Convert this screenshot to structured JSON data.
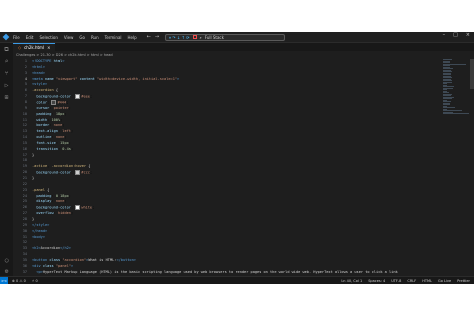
{
  "menu": [
    "File",
    "Edit",
    "Selection",
    "View",
    "Go",
    "Run",
    "Terminal",
    "Help"
  ],
  "search_text": "Full Stack",
  "tab": {
    "label": "ch2k.html"
  },
  "breadcrumb": "Challenges > 21-30 > D26 > ch2k.html > html > head",
  "code_lines": [
    {
      "n": "1",
      "h": "<span class='tag'>&lt;!DOCTYPE</span> <span class='att'>html</span><span class='tag'>&gt;</span>"
    },
    {
      "n": "2",
      "h": "<span class='tag'>&lt;html&gt;</span>"
    },
    {
      "n": "3",
      "h": "<span class='tag'>&lt;head&gt;</span>"
    },
    {
      "n": "4",
      "h": "<span class='tag'>&lt;meta</span> <span class='att'>name</span>=<span class='str'>\"viewport\"</span> <span class='att'>content</span>=<span class='str'>\"width=device-width, initial-scale=1\"</span><span class='tag'>&gt;</span>"
    },
    {
      "n": "5",
      "h": "<span class='tag'>&lt;style&gt;</span>"
    },
    {
      "n": "6",
      "h": "<span class='sel'>.accordion</span> <span class='pun'>{</span>"
    },
    {
      "n": "7",
      "h": "  <span class='prop'>background-color</span>: <span class='sw' style='background:#eee'></span><span class='val'>#eee</span>;"
    },
    {
      "n": "8",
      "h": "  <span class='prop'>color</span>: <span class='sw' style='background:#444'></span><span class='val'>#444</span>;"
    },
    {
      "n": "9",
      "h": "  <span class='prop'>cursor</span>: <span class='val'>pointer</span>;"
    },
    {
      "n": "10",
      "h": "  <span class='prop'>padding</span>: <span class='num'>18px</span>;"
    },
    {
      "n": "11",
      "h": "  <span class='prop'>width</span>: <span class='num'>100%</span>;"
    },
    {
      "n": "12",
      "h": "  <span class='prop'>border</span>: <span class='val'>none</span>;"
    },
    {
      "n": "13",
      "h": "  <span class='prop'>text-align</span>: <span class='val'>left</span>;"
    },
    {
      "n": "14",
      "h": "  <span class='prop'>outline</span>: <span class='val'>none</span>;"
    },
    {
      "n": "15",
      "h": "  <span class='prop'>font-size</span>: <span class='num'>15px</span>;"
    },
    {
      "n": "16",
      "h": "  <span class='prop'>transition</span>: <span class='num'>0.4s</span>;"
    },
    {
      "n": "17",
      "h": "<span class='pun'>}</span>"
    },
    {
      "n": "18",
      "h": ""
    },
    {
      "n": "19",
      "h": "<span class='sel'>.active</span>, <span class='sel'>.accordion:hover</span> <span class='pun'>{</span>"
    },
    {
      "n": "20",
      "h": "  <span class='prop'>background-color</span>: <span class='sw' style='background:#ccc'></span><span class='val'>#ccc</span>;"
    },
    {
      "n": "21",
      "h": "<span class='pun'>}</span>"
    },
    {
      "n": "22",
      "h": ""
    },
    {
      "n": "23",
      "h": "<span class='sel'>.panel</span> <span class='pun'>{</span>"
    },
    {
      "n": "24",
      "h": "  <span class='prop'>padding</span>: <span class='num'>0 18px</span>;"
    },
    {
      "n": "25",
      "h": "  <span class='prop'>display</span>: <span class='val'>none</span>;"
    },
    {
      "n": "26",
      "h": "  <span class='prop'>background-color</span>: <span class='sw' style='background:#fff'></span><span class='val'>white</span>;"
    },
    {
      "n": "27",
      "h": "  <span class='prop'>overflow</span>: <span class='val'>hidden</span>;"
    },
    {
      "n": "28",
      "h": "<span class='pun'>}</span>"
    },
    {
      "n": "29",
      "h": "<span class='tag'>&lt;/style&gt;</span>"
    },
    {
      "n": "30",
      "h": "<span class='tag'>&lt;/head&gt;</span>"
    },
    {
      "n": "31",
      "h": "<span class='tag'>&lt;body&gt;</span>"
    },
    {
      "n": "32",
      "h": ""
    },
    {
      "n": "33",
      "h": "<span class='tag'>&lt;h2&gt;</span><span class='txt'>Accordion</span><span class='tag'>&lt;/h2&gt;</span>"
    },
    {
      "n": "34",
      "h": ""
    },
    {
      "n": "35",
      "h": "<span class='tag'>&lt;button</span> <span class='att'>class</span>=<span class='str'>\"accordion\"</span><span class='tag'>&gt;</span><span class='txt'>What is HTML:</span><span class='tag'>&lt;/button&gt;</span>"
    },
    {
      "n": "36",
      "h": "<span class='tag'>&lt;div</span> <span class='att'>class</span>=<span class='str'>\"panel\"</span><span class='tag'>&gt;</span>"
    },
    {
      "n": "37",
      "h": "  <span class='tag'>&lt;p&gt;</span><span class='txt'>HyperText Markup Language (HTML) is the basic scripting language used by web browsers to render pages on the world wide web. HyperText allows a user to click a link</span>"
    }
  ],
  "status": {
    "left": [
      "⊗ 0 ⚠ 0",
      "⚡ 0"
    ],
    "right": [
      "Ln 40, Col 1",
      "Spaces: 4",
      "UTF-8",
      "CRLF",
      "HTML",
      "Go Live",
      "Prettier"
    ]
  }
}
